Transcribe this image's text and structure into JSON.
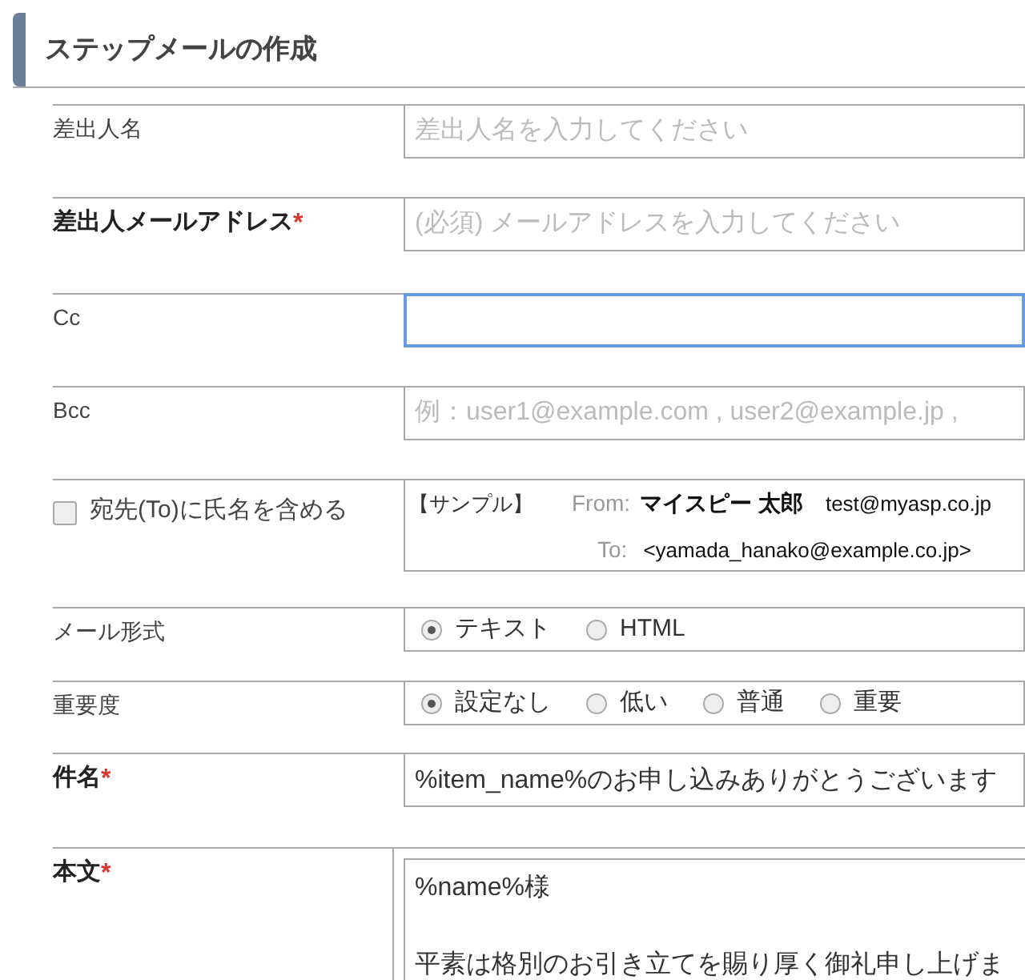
{
  "heading": "ステップメールの作成",
  "rows": [
    {
      "kind": "input",
      "label": "差出人名",
      "placeholder": "差出人名を入力してください",
      "focused": false
    },
    {
      "kind": "input",
      "label": "差出人メールアドレス",
      "required_mark": "*",
      "placeholder": "(必須) メールアドレスを入力してください",
      "focused": false
    },
    {
      "kind": "input",
      "label": "Cc",
      "focused": true
    },
    {
      "kind": "input",
      "label": "Bcc",
      "placeholder": "例：user1@example.com , user2@example.jp ,",
      "focused": false
    },
    {
      "kind": "sample",
      "label": "宛先(To)に氏名を含める",
      "checked": false,
      "sample": {
        "title": "【サンプル】",
        "from_label": "From:",
        "from_name": "マイスピー 太郎",
        "from_address": "test@myasp.co.jp",
        "to_label": "To:",
        "to_address": "<yamada_hanako@example.co.jp>"
      }
    },
    {
      "kind": "radio",
      "label": "メール形式",
      "options": [
        {
          "label": "テキスト",
          "selected": true
        },
        {
          "label": "HTML",
          "selected": false
        }
      ]
    },
    {
      "kind": "radio",
      "label": "重要度",
      "options": [
        {
          "label": "設定なし",
          "selected": true
        },
        {
          "label": "低い",
          "selected": false
        },
        {
          "label": "普通",
          "selected": false
        },
        {
          "label": "重要",
          "selected": false
        }
      ]
    },
    {
      "kind": "input",
      "label": "件名",
      "required_mark": "*",
      "value": "%item_name%のお申し込みありがとうございます",
      "focused": false
    },
    {
      "kind": "textarea",
      "label": "本文",
      "required_mark": "*",
      "paragraphs": [
        "%name%様",
        "平素は格別のお引き立てを賜り厚く御礼申し上げま"
      ]
    }
  ]
}
